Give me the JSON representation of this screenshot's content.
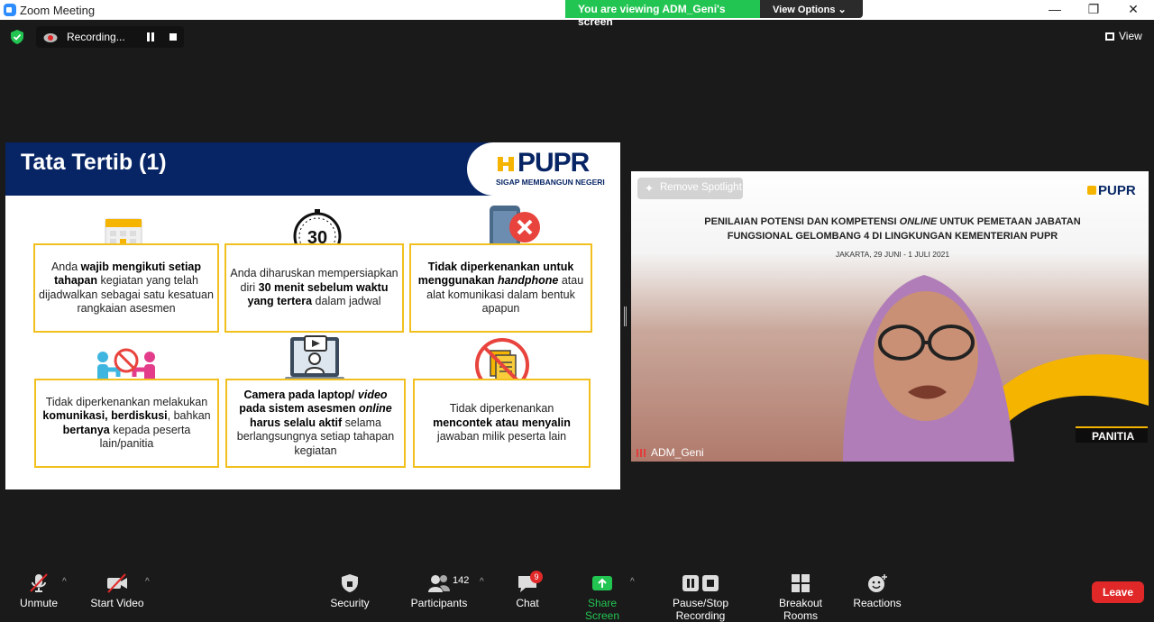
{
  "window": {
    "title": "Zoom Meeting",
    "minimize": "—",
    "maximize": "❐",
    "close": "✕"
  },
  "share_banner": {
    "viewing_text": "You are viewing ADM_Geni's screen",
    "view_options": "View Options ⌄"
  },
  "recording": {
    "label": "Recording..."
  },
  "top_right": {
    "view_label": "View"
  },
  "slide": {
    "title": "Tata Tertib (1)",
    "logo_text": "PUPR",
    "logo_tagline": "SIGAP MEMBANGUN NEGERI",
    "icon_30_label": "30",
    "rules": [
      {
        "pre": "Anda ",
        "bold": "wajib mengikuti setiap tahapan",
        "post": " kegiatan yang telah dijadwalkan sebagai satu kesatuan rangkaian asesmen"
      },
      {
        "pre": "Anda diharuskan mempersiapkan diri ",
        "bold": "30 menit sebelum waktu yang tertera",
        "post": " dalam jadwal"
      },
      {
        "bold": "Tidak diperkenankan untuk menggunakan ",
        "italic": "handphone",
        "post": " atau alat komunikasi dalam bentuk apapun"
      },
      {
        "pre": "Tidak diperkenankan melakukan ",
        "bold": "komunikasi, berdiskusi",
        "mid": ", bahkan ",
        "bold2": "bertanya",
        "post": " kepada peserta lain/panitia"
      },
      {
        "bold": "Camera pada laptop/ ",
        "italic": "video",
        "bold2": " pada sistem asesmen ",
        "italic2": "online",
        "bold3": " harus selalu aktif",
        "post": " selama berlangsungnya setiap tahapan kegiatan"
      },
      {
        "pre": "Tidak diperkenankan ",
        "bold": "mencontek atau menyalin",
        "post": " jawaban milik peserta lain"
      }
    ]
  },
  "video": {
    "participant_name": "ADM_Geni",
    "remove_spotlight": "Remove Spotlight",
    "logo_text": "PUPR",
    "heading_line1_pre": "PENILAIAN POTENSI DAN KOMPETENSI ",
    "heading_line1_italic": "ONLINE",
    "heading_line1_post": " UNTUK PEMETAAN JABATAN",
    "heading_line2": "FUNGSIONAL GELOMBANG 4 DI LINGKUNGAN KEMENTERIAN PUPR",
    "date_text": "JAKARTA, 29 JUNI - 1 JULI 2021",
    "badge_text": "PANITIA"
  },
  "toolbar": {
    "unmute": "Unmute",
    "start_video": "Start Video",
    "security": "Security",
    "participants": "Participants",
    "participants_count": "142",
    "chat": "Chat",
    "chat_badge": "9",
    "share_screen": "Share Screen",
    "pause_stop_recording": "Pause/Stop Recording",
    "breakout_rooms": "Breakout Rooms",
    "reactions": "Reactions",
    "leave": "Leave"
  },
  "colors": {
    "zoom_blue": "#2d8cff",
    "share_green": "#23c552",
    "slide_navy": "#072565",
    "rule_yellow": "#f2c01e",
    "leave_red": "#e02828"
  }
}
